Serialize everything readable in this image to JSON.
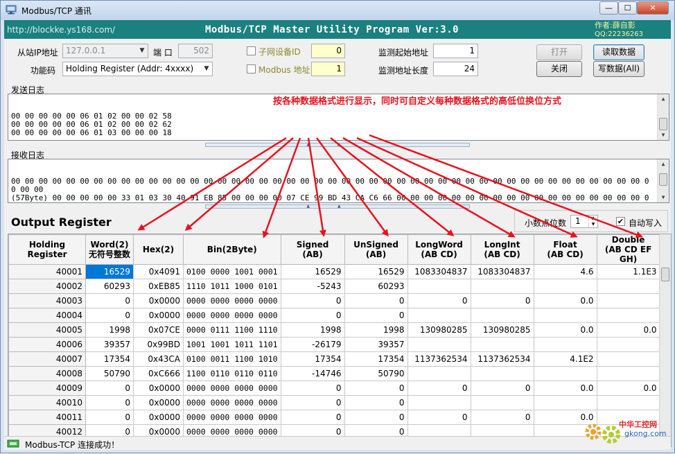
{
  "window": {
    "title": "Modbus/TCP 通讯",
    "min_glyph": "—",
    "max_glyph": "☐",
    "close_glyph": "✕",
    "icon": "network-computer-icon"
  },
  "banner": {
    "url": "http://blockke.ys168.com/",
    "program": "Modbus/TCP Master Utility Program  Ver:3.0",
    "author": "作者:薛自影",
    "qq": "QQ:22236263",
    "color": "#1b8080"
  },
  "settings": {
    "slave_ip_label": "从站IP地址",
    "slave_ip_value": "127.0.0.1",
    "port_label": "端 口",
    "port_value": "502",
    "function_label": "功能码",
    "function_value": "Holding Register (Addr: 4xxxx)",
    "subnet_label": "子网设备ID",
    "subnet_value": "0",
    "modbus_addr_label": "Modbus 地址",
    "modbus_addr_value": "1",
    "start_addr_label": "监测起始地址",
    "start_addr_value": "1",
    "length_label": "监测地址长度",
    "length_value": "24"
  },
  "buttons": {
    "open": "打开",
    "close": "关闭",
    "read": "读取数据",
    "write": "写数据(All)"
  },
  "send_log": {
    "title": "发送日志",
    "text": "00 00 00 00 00 06 01 02 00 00 02 58\n00 00 00 00 00 06 01 02 00 00 02 62\n00 00 00 00 00 06 01 03 00 00 00 18"
  },
  "recv_log": {
    "title": "接收日志",
    "text": "00 00 00 00 00 00 00 00 00 00 00 00 00 00 00 00 00 00 00 00 00 00 00 00 00 00 00 00 00 00 00 00 00 00 00 00 00 00 00 00 00 00 00 00 00 00 00 00 00\n(57Byte) 00 00 00 00 00 33 01 03 30 40 91 EB 85 00 00 00 00 07 CE 99 BD 43 CA C6 66 00 00 00 00 00 00 00 00 00 00 00 00 00 00 00 00 00 00 00 00 00 00 00 00 00 00 00 00\n00 00 00 00 00 00 00 00 00 00"
  },
  "annotation": "按各种数据格式进行显示，同时可自定义每种数据格式的高低位换位方式",
  "output": {
    "title": "Output Register",
    "decimal_label": "小数点位数",
    "decimal_value": "1",
    "auto_write_label": "自动写入",
    "auto_write_checked": true,
    "columns": [
      {
        "l1": "Holding Register",
        "l2": ""
      },
      {
        "l1": "Word(2)",
        "l2": "无符号整数"
      },
      {
        "l1": "Hex(2)",
        "l2": ""
      },
      {
        "l1": "Bin(2Byte)",
        "l2": ""
      },
      {
        "l1": "Signed",
        "l2": "(AB)"
      },
      {
        "l1": "UnSigned",
        "l2": "(AB)"
      },
      {
        "l1": "LongWord",
        "l2": "(AB CD)"
      },
      {
        "l1": "LongInt",
        "l2": "(AB CD)"
      },
      {
        "l1": "Float",
        "l2": "(AB CD)"
      },
      {
        "l1": "Double",
        "l2": "(AB CD EF GH)"
      }
    ],
    "rows": [
      [
        "40001",
        "16529",
        "0x4091",
        "0100 0000 1001 0001",
        "16529",
        "16529",
        "1083304837",
        "1083304837",
        "4.6",
        "1.1E3"
      ],
      [
        "40002",
        "60293",
        "0xEB85",
        "1110 1011 1000 0101",
        "-5243",
        "60293",
        "",
        "",
        "",
        ""
      ],
      [
        "40003",
        "0",
        "0x0000",
        "0000 0000 0000 0000",
        "0",
        "0",
        "0",
        "0",
        "0.0",
        ""
      ],
      [
        "40004",
        "0",
        "0x0000",
        "0000 0000 0000 0000",
        "0",
        "0",
        "",
        "",
        "",
        ""
      ],
      [
        "40005",
        "1998",
        "0x07CE",
        "0000 0111 1100 1110",
        "1998",
        "1998",
        "130980285",
        "130980285",
        "0.0",
        "0.0"
      ],
      [
        "40006",
        "39357",
        "0x99BD",
        "1001 1001 1011 1101",
        "-26179",
        "39357",
        "",
        "",
        "",
        ""
      ],
      [
        "40007",
        "17354",
        "0x43CA",
        "0100 0011 1100 1010",
        "17354",
        "17354",
        "1137362534",
        "1137362534",
        "4.1E2",
        ""
      ],
      [
        "40008",
        "50790",
        "0xC666",
        "1100 0110 0110 0110",
        "-14746",
        "50790",
        "",
        "",
        "",
        ""
      ],
      [
        "40009",
        "0",
        "0x0000",
        "0000 0000 0000 0000",
        "0",
        "0",
        "0",
        "0",
        "0.0",
        "0.0"
      ],
      [
        "40010",
        "0",
        "0x0000",
        "0000 0000 0000 0000",
        "0",
        "0",
        "",
        "",
        "",
        ""
      ],
      [
        "40011",
        "0",
        "0x0000",
        "0000 0000 0000 0000",
        "0",
        "0",
        "0",
        "0",
        "0.0",
        ""
      ],
      [
        "40012",
        "0",
        "0x0000",
        "0000 0000 0000 0000",
        "0",
        "0",
        "",
        "",
        "",
        ""
      ]
    ],
    "selected_cell": {
      "row": 0,
      "col": 1
    }
  },
  "status": {
    "text": "Modbus-TCP 连接成功！",
    "icon": "network-connected-icon"
  },
  "watermark": {
    "name": "中华工控网",
    "url": "gkong.com"
  }
}
